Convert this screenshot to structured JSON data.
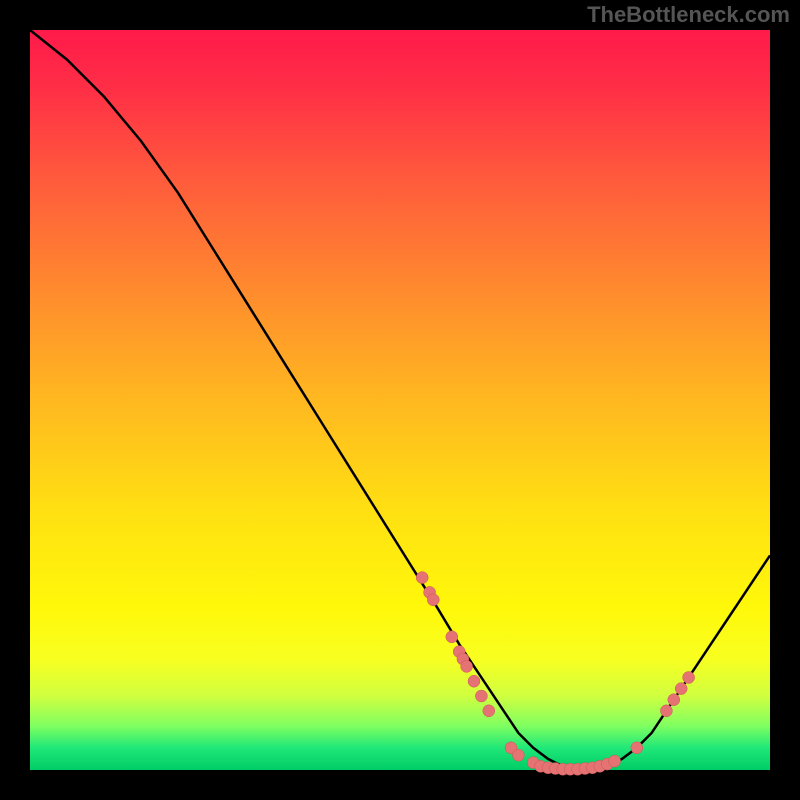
{
  "watermark": "TheBottleneck.com",
  "chart_data": {
    "type": "line",
    "title": "",
    "xlabel": "",
    "ylabel": "",
    "xlim": [
      0,
      100
    ],
    "ylim": [
      0,
      100
    ],
    "series": [
      {
        "name": "bottleneck-curve",
        "x": [
          0,
          5,
          10,
          15,
          20,
          25,
          30,
          35,
          40,
          45,
          50,
          55,
          58,
          60,
          62,
          64,
          66,
          68,
          70,
          72,
          74,
          76,
          78,
          80,
          82,
          84,
          86,
          88,
          90,
          92,
          94,
          96,
          98,
          100
        ],
        "values": [
          100,
          96,
          91,
          85,
          78,
          70,
          62,
          54,
          46,
          38,
          30,
          22,
          17,
          14,
          11,
          8,
          5,
          3,
          1.5,
          0.5,
          0,
          0,
          0.5,
          1.5,
          3,
          5,
          8,
          11,
          14,
          17,
          20,
          23,
          26,
          29
        ]
      }
    ],
    "scatter_points": [
      {
        "x": 53,
        "y": 26
      },
      {
        "x": 54,
        "y": 24
      },
      {
        "x": 54.5,
        "y": 23
      },
      {
        "x": 57,
        "y": 18
      },
      {
        "x": 58,
        "y": 16
      },
      {
        "x": 58.5,
        "y": 15
      },
      {
        "x": 59,
        "y": 14
      },
      {
        "x": 60,
        "y": 12
      },
      {
        "x": 61,
        "y": 10
      },
      {
        "x": 62,
        "y": 8
      },
      {
        "x": 65,
        "y": 3
      },
      {
        "x": 66,
        "y": 2
      },
      {
        "x": 68,
        "y": 1
      },
      {
        "x": 69,
        "y": 0.5
      },
      {
        "x": 70,
        "y": 0.3
      },
      {
        "x": 71,
        "y": 0.2
      },
      {
        "x": 72,
        "y": 0.1
      },
      {
        "x": 73,
        "y": 0.1
      },
      {
        "x": 74,
        "y": 0.1
      },
      {
        "x": 75,
        "y": 0.2
      },
      {
        "x": 76,
        "y": 0.3
      },
      {
        "x": 77,
        "y": 0.5
      },
      {
        "x": 78,
        "y": 0.8
      },
      {
        "x": 79,
        "y": 1.2
      },
      {
        "x": 82,
        "y": 3
      },
      {
        "x": 86,
        "y": 8
      },
      {
        "x": 87,
        "y": 9.5
      },
      {
        "x": 88,
        "y": 11
      },
      {
        "x": 89,
        "y": 12.5
      }
    ]
  }
}
